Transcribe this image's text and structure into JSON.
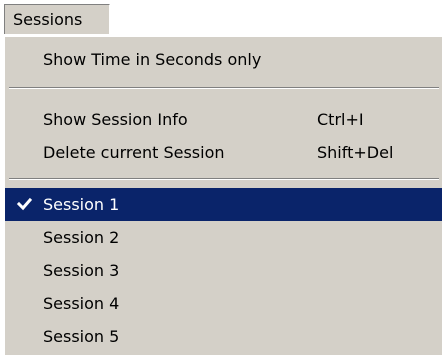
{
  "menubar": {
    "sessions_label": "Sessions"
  },
  "menu": {
    "show_time_seconds": "Show Time in Seconds only",
    "show_session_info": {
      "label": "Show Session Info",
      "shortcut": "Ctrl+I"
    },
    "delete_session": {
      "label": "Delete current Session",
      "shortcut": "Shift+Del"
    },
    "sessions": [
      {
        "label": "Session 1",
        "checked": true
      },
      {
        "label": "Session 2",
        "checked": false
      },
      {
        "label": "Session 3",
        "checked": false
      },
      {
        "label": "Session 4",
        "checked": false
      },
      {
        "label": "Session 5",
        "checked": false
      }
    ]
  },
  "colors": {
    "menu_bg": "#d4d0c8",
    "highlight_bg": "#0a246a",
    "highlight_text": "#ffffff"
  },
  "icons": {
    "checkmark": "checkmark-icon"
  }
}
